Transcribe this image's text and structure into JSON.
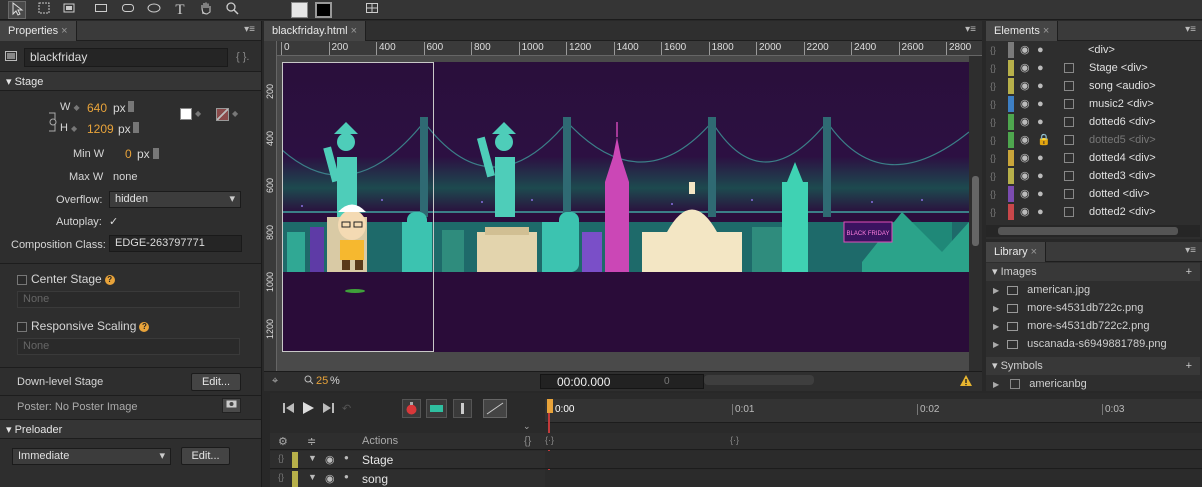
{
  "tools": {
    "select_icon": "arrow-select",
    "transform_icon": "transform",
    "clip_icon": "clipping",
    "rect_icon": "rectangle",
    "rounded_rect_icon": "rounded-rectangle",
    "ellipse_icon": "ellipse",
    "text_tool": "T",
    "hand_icon": "hand",
    "zoom_icon": "magnifier"
  },
  "properties": {
    "tab": "Properties",
    "element_id": "blackfriday",
    "stage_label": "Stage",
    "w_label": "W",
    "w_value": "640",
    "w_unit": "px",
    "h_label": "H",
    "h_value": "1209",
    "h_unit": "px",
    "minw_label": "Min W",
    "minw_value": "0",
    "minw_unit": "px",
    "maxw_label": "Max W",
    "maxw_value": "none",
    "overflow_label": "Overflow:",
    "overflow_value": "hidden",
    "autoplay_label": "Autoplay:",
    "autoplay_check": "✓",
    "composition_label": "Composition Class:",
    "composition_value": "EDGE-263797771",
    "center_stage": "Center Stage",
    "center_none": "None",
    "responsive_scaling": "Responsive Scaling",
    "responsive_none": "None",
    "downlevel_label": "Down-level Stage",
    "edit": "Edit...",
    "poster_label": "Poster: No Poster Image",
    "preloader_label": "Preloader",
    "preloader_value": "Immediate",
    "preloader_edit": "Edit..."
  },
  "document": {
    "tab": "blackfriday.html",
    "ruler_ticks": [
      "0",
      "200",
      "400",
      "600",
      "800",
      "1000",
      "1200",
      "1400",
      "1600",
      "1800",
      "2000",
      "2200",
      "2400",
      "2600",
      "2800"
    ],
    "vruler_ticks": [
      "200",
      "400",
      "600",
      "800",
      "1000",
      "1200"
    ],
    "zoom": "25",
    "zoom_unit": "%",
    "timecode": "00:00.000",
    "frame": "0"
  },
  "elements": {
    "tab": "Elements",
    "rows": [
      {
        "name": "",
        "tag": "<div>",
        "color": "#7a7a7a",
        "special": "</>"
      },
      {
        "name": "Stage",
        "tag": "<div>",
        "color": "#b7b04a"
      },
      {
        "name": "song",
        "tag": "<audio>",
        "color": "#b7b04a"
      },
      {
        "name": "music2",
        "tag": "<div>",
        "color": "#3d7fc4"
      },
      {
        "name": "dotted6",
        "tag": "<div>",
        "color": "#4ea64e"
      },
      {
        "name": "dotted5",
        "tag": "<div>",
        "color": "#4ea64e"
      },
      {
        "name": "dotted4",
        "tag": "<div>",
        "color": "#c9a53a"
      },
      {
        "name": "dotted3",
        "tag": "<div>",
        "color": "#b7b04a"
      },
      {
        "name": "dotted",
        "tag": "<div>",
        "color": "#7b4cb0"
      },
      {
        "name": "dotted2",
        "tag": "<div>",
        "color": "#c8474a"
      }
    ]
  },
  "library": {
    "tab": "Library",
    "images_label": "Images",
    "images": [
      "american.jpg",
      "more-s4531db722c.png",
      "more-s4531db722c2.png",
      "uscanada-s6949881789.png"
    ],
    "symbols_label": "Symbols",
    "symbols": [
      "americanbg"
    ]
  },
  "timeline": {
    "time_0": "0:00",
    "time_1": "0:01",
    "time_2": "0:02",
    "time_3": "0:03",
    "actions_label": "Actions",
    "rows": [
      "Stage",
      "song"
    ]
  },
  "colors": {
    "accent": "#e8a33a",
    "stage_bg": "#2a0f3b",
    "panel_bg": "#2e2e2e"
  }
}
